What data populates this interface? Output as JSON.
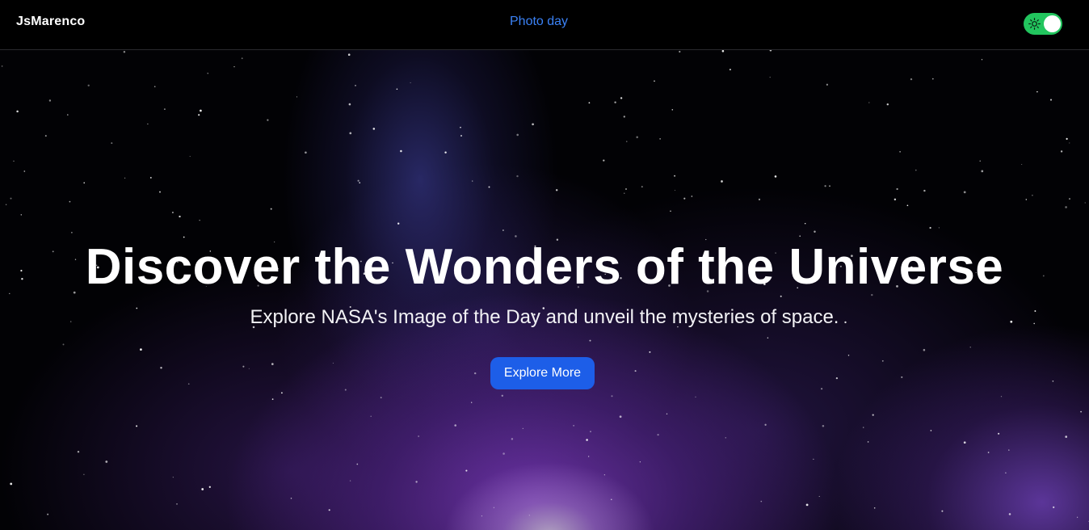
{
  "navbar": {
    "brand": "JsMarenco",
    "links": [
      {
        "label": "Photo day"
      }
    ],
    "theme_toggle": {
      "state": "on",
      "icon": "sun-icon"
    }
  },
  "hero": {
    "title": "Discover the Wonders of the Universe",
    "subtitle": "Explore NASA's Image of the Day and unveil the mysteries of space.",
    "cta_label": "Explore More"
  },
  "colors": {
    "nav_link": "#3b82f6",
    "toggle_on": "#22c55e",
    "cta_background": "#1d5ee8",
    "nebula_purple": "#7c3abe",
    "background": "#000000"
  }
}
